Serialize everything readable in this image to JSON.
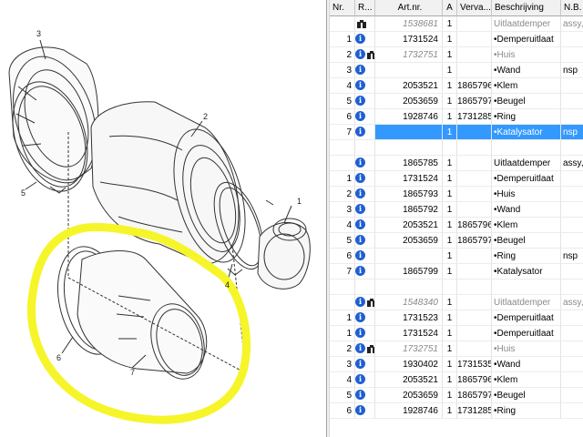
{
  "colors": {
    "highlight_yellow": "#f5f52a",
    "selection_blue": "#3399ff",
    "info_icon_blue": "#1f5fd3"
  },
  "drawing": {
    "callouts": [
      "1",
      "2",
      "3",
      "4",
      "5",
      "6",
      "7"
    ]
  },
  "table": {
    "headers": {
      "nr": "Nr.",
      "r": "R...",
      "art": "Art.nr.",
      "a": "A",
      "vervangt": "Verva...",
      "beschrijving": "Beschrijving",
      "nb": "N.B."
    },
    "rows": [
      {
        "nr": "",
        "icons": "bino",
        "art": "1538681",
        "a": "1",
        "ver": "",
        "beschr": "Uitlaatdemper",
        "nb": "assy,",
        "style": "grey"
      },
      {
        "nr": "1",
        "icons": "info",
        "art": "1731524",
        "a": "1",
        "ver": "",
        "beschr": "•Demperuitlaat",
        "nb": "",
        "style": ""
      },
      {
        "nr": "2",
        "icons": "info-bino",
        "art": "1732751",
        "a": "1",
        "ver": "",
        "beschr": "•Huis",
        "nb": "",
        "style": "grey"
      },
      {
        "nr": "3",
        "icons": "info",
        "art": "",
        "a": "1",
        "ver": "",
        "beschr": "•Wand",
        "nb": "nsp",
        "style": ""
      },
      {
        "nr": "4",
        "icons": "info",
        "art": "2053521",
        "a": "1",
        "ver": "1865796",
        "beschr": "•Klem",
        "nb": "",
        "style": ""
      },
      {
        "nr": "5",
        "icons": "info",
        "art": "2053659",
        "a": "1",
        "ver": "1865797",
        "beschr": "•Beugel",
        "nb": "",
        "style": ""
      },
      {
        "nr": "6",
        "icons": "info",
        "art": "1928746",
        "a": "1",
        "ver": "1731285",
        "beschr": "•Ring",
        "nb": "",
        "style": ""
      },
      {
        "nr": "7",
        "icons": "info",
        "art": "",
        "a": "1",
        "ver": "",
        "beschr": "•Katalysator",
        "nb": "nsp",
        "style": "sel"
      },
      {
        "nr": "",
        "icons": "",
        "art": "",
        "a": "",
        "ver": "",
        "beschr": "",
        "nb": "",
        "style": ""
      },
      {
        "nr": "",
        "icons": "info",
        "art": "1865785",
        "a": "1",
        "ver": "",
        "beschr": "Uitlaatdemper",
        "nb": "assy,",
        "style": ""
      },
      {
        "nr": "1",
        "icons": "info",
        "art": "1731524",
        "a": "1",
        "ver": "",
        "beschr": "•Demperuitlaat",
        "nb": "",
        "style": ""
      },
      {
        "nr": "2",
        "icons": "info",
        "art": "1865793",
        "a": "1",
        "ver": "",
        "beschr": "•Huis",
        "nb": "",
        "style": ""
      },
      {
        "nr": "3",
        "icons": "info",
        "art": "1865792",
        "a": "1",
        "ver": "",
        "beschr": "•Wand",
        "nb": "",
        "style": ""
      },
      {
        "nr": "4",
        "icons": "info",
        "art": "2053521",
        "a": "1",
        "ver": "1865796",
        "beschr": "•Klem",
        "nb": "",
        "style": ""
      },
      {
        "nr": "5",
        "icons": "info",
        "art": "2053659",
        "a": "1",
        "ver": "1865797",
        "beschr": "•Beugel",
        "nb": "",
        "style": ""
      },
      {
        "nr": "6",
        "icons": "info",
        "art": "",
        "a": "1",
        "ver": "",
        "beschr": "•Ring",
        "nb": "nsp",
        "style": ""
      },
      {
        "nr": "7",
        "icons": "info",
        "art": "1865799",
        "a": "1",
        "ver": "",
        "beschr": "•Katalysator",
        "nb": "",
        "style": ""
      },
      {
        "nr": "",
        "icons": "",
        "art": "",
        "a": "",
        "ver": "",
        "beschr": "",
        "nb": "",
        "style": ""
      },
      {
        "nr": "",
        "icons": "info-bino",
        "art": "1548340",
        "a": "1",
        "ver": "",
        "beschr": "Uitlaatdemper",
        "nb": "assy,",
        "style": "grey"
      },
      {
        "nr": "1",
        "icons": "info",
        "art": "1731523",
        "a": "1",
        "ver": "",
        "beschr": "•Demperuitlaat",
        "nb": "",
        "style": ""
      },
      {
        "nr": "1",
        "icons": "info",
        "art": "1731524",
        "a": "1",
        "ver": "",
        "beschr": "•Demperuitlaat",
        "nb": "",
        "style": ""
      },
      {
        "nr": "2",
        "icons": "info-bino",
        "art": "1732751",
        "a": "1",
        "ver": "",
        "beschr": "•Huis",
        "nb": "",
        "style": "grey"
      },
      {
        "nr": "3",
        "icons": "info",
        "art": "1930402",
        "a": "1",
        "ver": "1731535",
        "beschr": "•Wand",
        "nb": "",
        "style": ""
      },
      {
        "nr": "4",
        "icons": "info",
        "art": "2053521",
        "a": "1",
        "ver": "1865796",
        "beschr": "•Klem",
        "nb": "",
        "style": ""
      },
      {
        "nr": "5",
        "icons": "info",
        "art": "2053659",
        "a": "1",
        "ver": "1865797",
        "beschr": "•Beugel",
        "nb": "",
        "style": ""
      },
      {
        "nr": "6",
        "icons": "info",
        "art": "1928746",
        "a": "1",
        "ver": "1731285",
        "beschr": "•Ring",
        "nb": "",
        "style": ""
      }
    ]
  }
}
